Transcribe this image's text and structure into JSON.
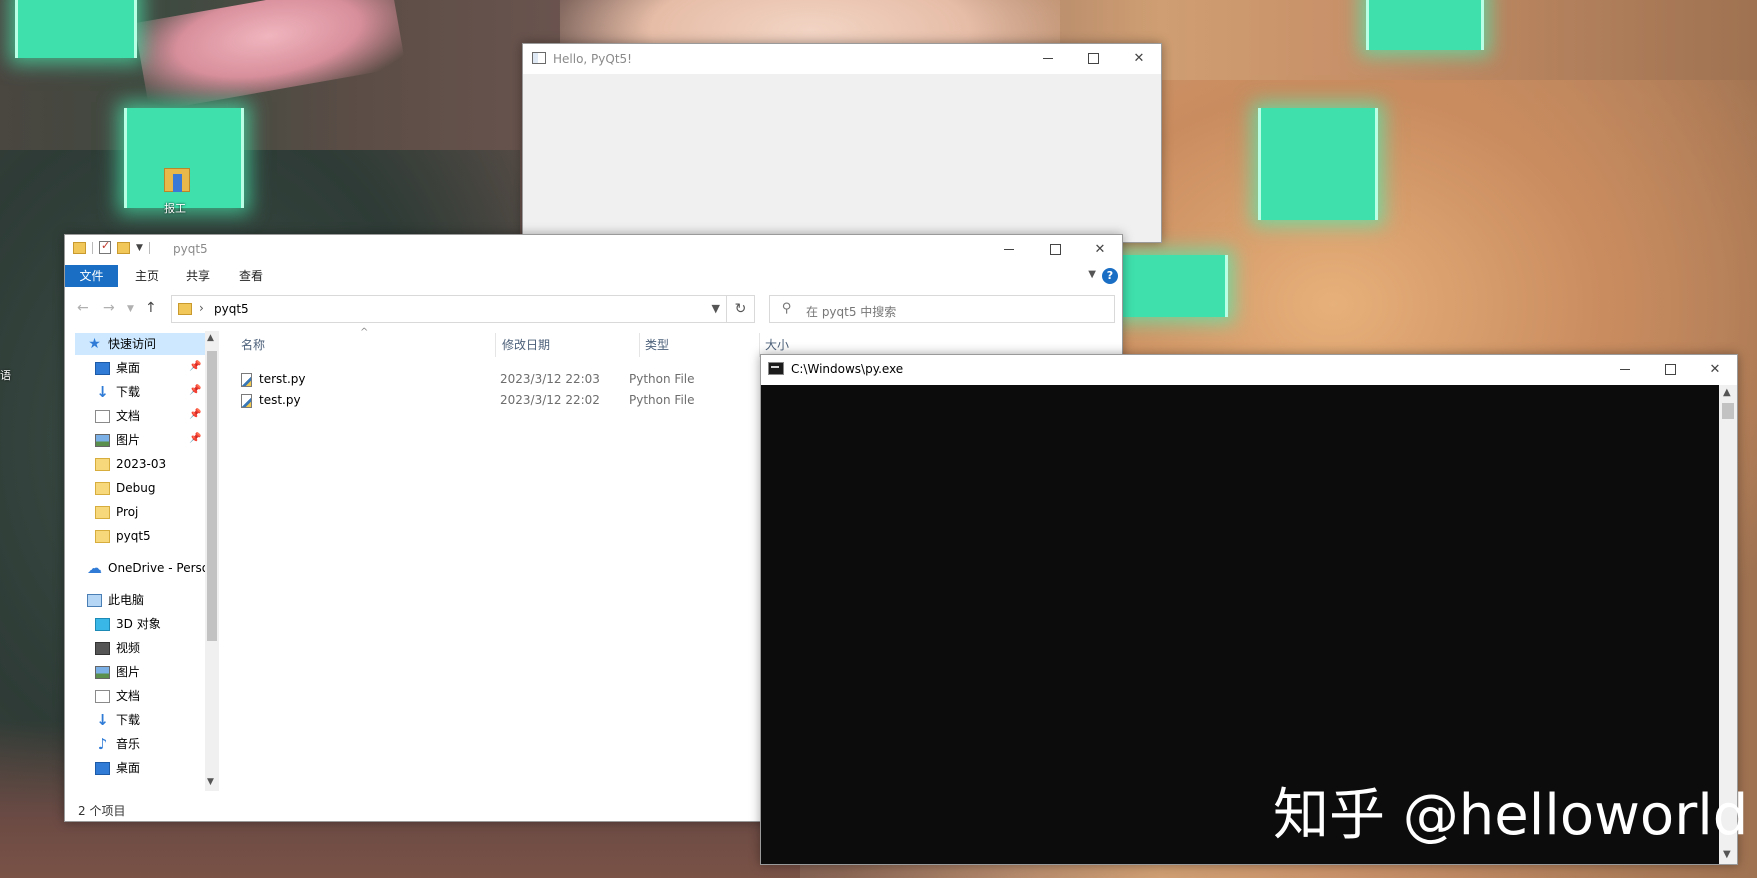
{
  "desktop": {
    "icon_label": "报工",
    "edge_text": "语"
  },
  "pyqt_window": {
    "title": "Hello, PyQt5!"
  },
  "explorer": {
    "title": "pyqt5",
    "ribbon_tabs": [
      "文件",
      "主页",
      "共享",
      "查看"
    ],
    "address_path": "pyqt5",
    "search_placeholder": "在 pyqt5 中搜索",
    "nav_items": [
      {
        "label": "快速访问",
        "icon": "star-icon"
      },
      {
        "label": "桌面",
        "icon": "desktop-icon",
        "pinned": true
      },
      {
        "label": "下载",
        "icon": "download-icon",
        "pinned": true
      },
      {
        "label": "文档",
        "icon": "document-icon",
        "pinned": true
      },
      {
        "label": "图片",
        "icon": "picture-icon",
        "pinned": true
      },
      {
        "label": "2023-03",
        "icon": "folder-icon"
      },
      {
        "label": "Debug",
        "icon": "folder-icon"
      },
      {
        "label": "Proj",
        "icon": "folder-icon"
      },
      {
        "label": "pyqt5",
        "icon": "folder-icon"
      },
      {
        "label": "OneDrive - Personal",
        "icon": "onedrive-icon"
      },
      {
        "label": "此电脑",
        "icon": "pc-icon"
      },
      {
        "label": "3D 对象",
        "icon": "3d-objects-icon"
      },
      {
        "label": "视频",
        "icon": "video-icon"
      },
      {
        "label": "图片",
        "icon": "picture-icon"
      },
      {
        "label": "文档",
        "icon": "document-icon"
      },
      {
        "label": "下载",
        "icon": "download-icon"
      },
      {
        "label": "音乐",
        "icon": "music-icon"
      },
      {
        "label": "桌面",
        "icon": "desktop-icon"
      }
    ],
    "columns": [
      "名称",
      "修改日期",
      "类型",
      "大小"
    ],
    "files": [
      {
        "name": "terst.py",
        "modified": "2023/3/12 22:03",
        "type": "Python File"
      },
      {
        "name": "test.py",
        "modified": "2023/3/12 22:02",
        "type": "Python File"
      }
    ],
    "status": "2 个项目"
  },
  "console": {
    "title": "C:\\Windows\\py.exe"
  },
  "watermark": "知乎 @helloworld",
  "colors": {
    "accent": "#1a6fc4",
    "console_bg": "#0c0c0c",
    "selection": "#cde8ff"
  }
}
